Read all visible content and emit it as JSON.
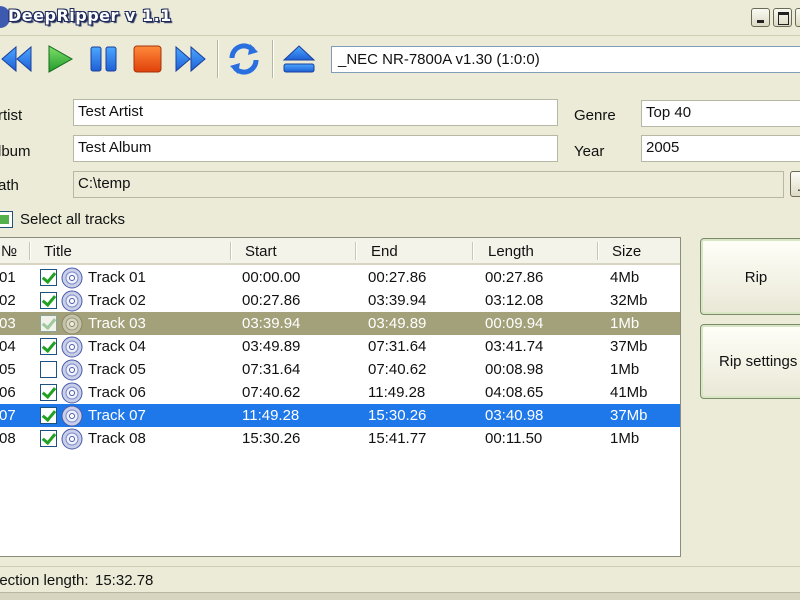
{
  "window": {
    "title": "DeepRipper v 1.1"
  },
  "toolbar": {
    "drive": "_NEC NR-7800A v1.30 (1:0:0)",
    "icons": [
      "rewind-icon",
      "play-icon",
      "pause-icon",
      "stop-icon",
      "fast-forward-icon",
      "refresh-icon",
      "eject-icon"
    ]
  },
  "form": {
    "artist_label": "rtist",
    "artist_value": "Test Artist",
    "album_label": "lbum",
    "album_value": "Test Album",
    "path_label": "ath",
    "path_value": "C:\\temp",
    "genre_label": "Genre",
    "genre_value": "Top 40",
    "year_label": "Year",
    "year_value": "2005"
  },
  "select_all": {
    "label": "Select all tracks"
  },
  "tracklist": {
    "columns": {
      "num": "№",
      "title": "Title",
      "start": "Start",
      "end": "End",
      "length": "Length",
      "size": "Size"
    },
    "rows": [
      {
        "num": "01",
        "title": "Track 01",
        "start": "00:00.00",
        "end": "00:27.86",
        "length": "00:27.86",
        "size": "4Mb"
      },
      {
        "num": "02",
        "title": "Track 02",
        "start": "00:27.86",
        "end": "03:39.94",
        "length": "03:12.08",
        "size": "32Mb"
      },
      {
        "num": "03",
        "title": "Track 03",
        "start": "03:39.94",
        "end": "03:49.89",
        "length": "00:09.94",
        "size": "1Mb"
      },
      {
        "num": "04",
        "title": "Track 04",
        "start": "03:49.89",
        "end": "07:31.64",
        "length": "03:41.74",
        "size": "37Mb"
      },
      {
        "num": "05",
        "title": "Track 05",
        "start": "07:31.64",
        "end": "07:40.62",
        "length": "00:08.98",
        "size": "1Mb"
      },
      {
        "num": "06",
        "title": "Track 06",
        "start": "07:40.62",
        "end": "11:49.28",
        "length": "04:08.65",
        "size": "41Mb"
      },
      {
        "num": "07",
        "title": "Track 07",
        "start": "11:49.28",
        "end": "15:30.26",
        "length": "03:40.98",
        "size": "37Mb"
      },
      {
        "num": "08",
        "title": "Track 08",
        "start": "15:30.26",
        "end": "15:41.77",
        "length": "00:11.50",
        "size": "1Mb"
      }
    ]
  },
  "buttons": {
    "rip": "Rip",
    "rip_settings": "Rip settings"
  },
  "status": {
    "label": "lection length:",
    "value": "15:32.78"
  },
  "colors": {
    "selected_blue": "#1e78ea",
    "selected_gray": "#a3a17a",
    "window_bg": "#ecebd8"
  }
}
